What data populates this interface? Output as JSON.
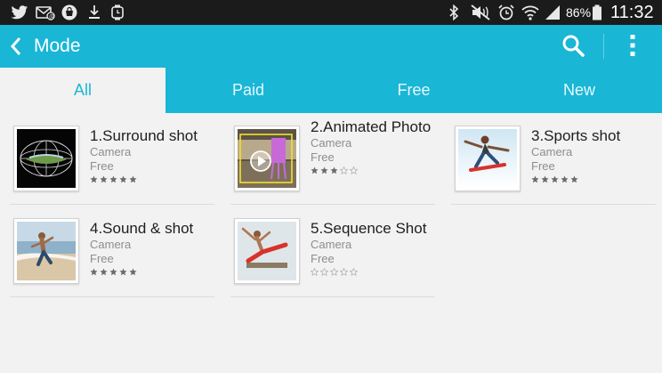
{
  "status_bar": {
    "battery_percent": "86%",
    "time": "11:32"
  },
  "action_bar": {
    "title": "Mode"
  },
  "tabs": [
    {
      "label": "All",
      "active": true
    },
    {
      "label": "Paid",
      "active": false
    },
    {
      "label": "Free",
      "active": false
    },
    {
      "label": "New",
      "active": false
    }
  ],
  "modes": [
    {
      "name": "1.Surround shot",
      "category": "Camera",
      "price": "Free",
      "rating": 5
    },
    {
      "name": "2.Animated Photo",
      "category": "Camera",
      "price": "Free",
      "rating": 3
    },
    {
      "name": "3.Sports shot",
      "category": "Camera",
      "price": "Free",
      "rating": 5
    },
    {
      "name": "4.Sound & shot",
      "category": "Camera",
      "price": "Free",
      "rating": 5
    },
    {
      "name": "5.Sequence Shot",
      "category": "Camera",
      "price": "Free",
      "rating": 0
    }
  ],
  "colors": {
    "accent": "#19b6d6",
    "status_bar": "#1b1b1b",
    "background": "#f2f2f2",
    "star_filled": "#6b6b6b",
    "star_empty": "#b5b5b5"
  },
  "icons": {
    "status_left": [
      "twitter-icon",
      "mail-icon",
      "bag-icon",
      "download-icon",
      "watch-icon"
    ],
    "status_right": [
      "bluetooth-icon",
      "mute-icon",
      "alarm-icon",
      "wifi-icon",
      "signal-icon",
      "battery-icon"
    ],
    "action_bar": [
      "back-chevron-icon",
      "search-icon",
      "overflow-menu-icon"
    ]
  }
}
